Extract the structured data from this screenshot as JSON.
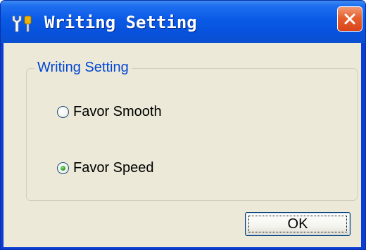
{
  "window": {
    "title": "Writing Setting",
    "app_icon": "tools-icon",
    "close_icon": "close-icon",
    "title_color": "#ffffff",
    "accent_color": "#0a5ae6",
    "close_color": "#d9441a"
  },
  "group": {
    "label": "Writing Setting",
    "label_color": "#0046d5"
  },
  "options": [
    {
      "label": "Favor Smooth",
      "selected": false
    },
    {
      "label": "Favor Speed",
      "selected": true
    }
  ],
  "buttons": {
    "ok_label": "OK"
  }
}
